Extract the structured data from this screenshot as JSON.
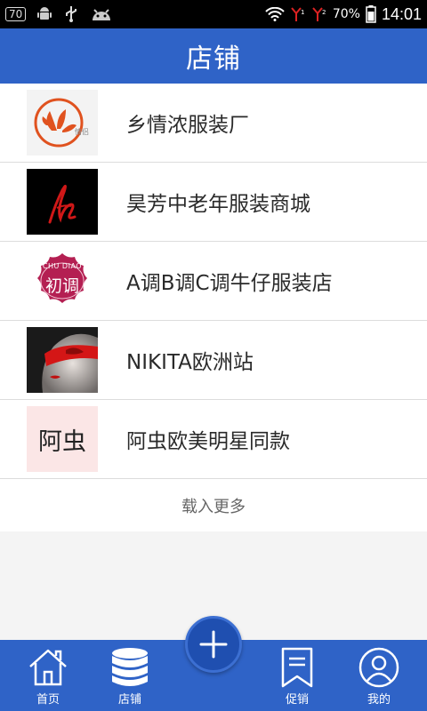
{
  "status_bar": {
    "badge": "70",
    "battery": "70%",
    "time": "14:01",
    "icons": [
      "android-icon",
      "usb-icon",
      "android-robot-icon",
      "wifi-icon",
      "signal-icon-1",
      "signal-icon-2",
      "battery-icon"
    ]
  },
  "header": {
    "title": "店铺"
  },
  "shops": [
    {
      "name": "乡情浓服装厂",
      "logo": "flower-logo",
      "logo_text": "情侣"
    },
    {
      "name": "昊芳中老年服装商城",
      "logo": "script-logo"
    },
    {
      "name": "A调B调C调牛仔服装店",
      "logo": "chudiao-logo",
      "logo_top": "CHU DIAO",
      "logo_main": "初调"
    },
    {
      "name": "NIKITA欧洲站",
      "logo": "red-mask-logo"
    },
    {
      "name": "阿虫欧美明星同款",
      "logo": "text-logo",
      "logo_text": "阿虫"
    }
  ],
  "load_more": "载入更多",
  "bottom_nav": {
    "items": [
      {
        "label": "首页",
        "icon": "home-icon"
      },
      {
        "label": "店铺",
        "icon": "database-icon"
      },
      {
        "label": "促销",
        "icon": "bookmark-icon"
      },
      {
        "label": "我的",
        "icon": "user-icon"
      }
    ],
    "fab_icon": "plus-icon"
  },
  "colors": {
    "primary": "#2f63c7",
    "fab": "#1f4fb0"
  }
}
